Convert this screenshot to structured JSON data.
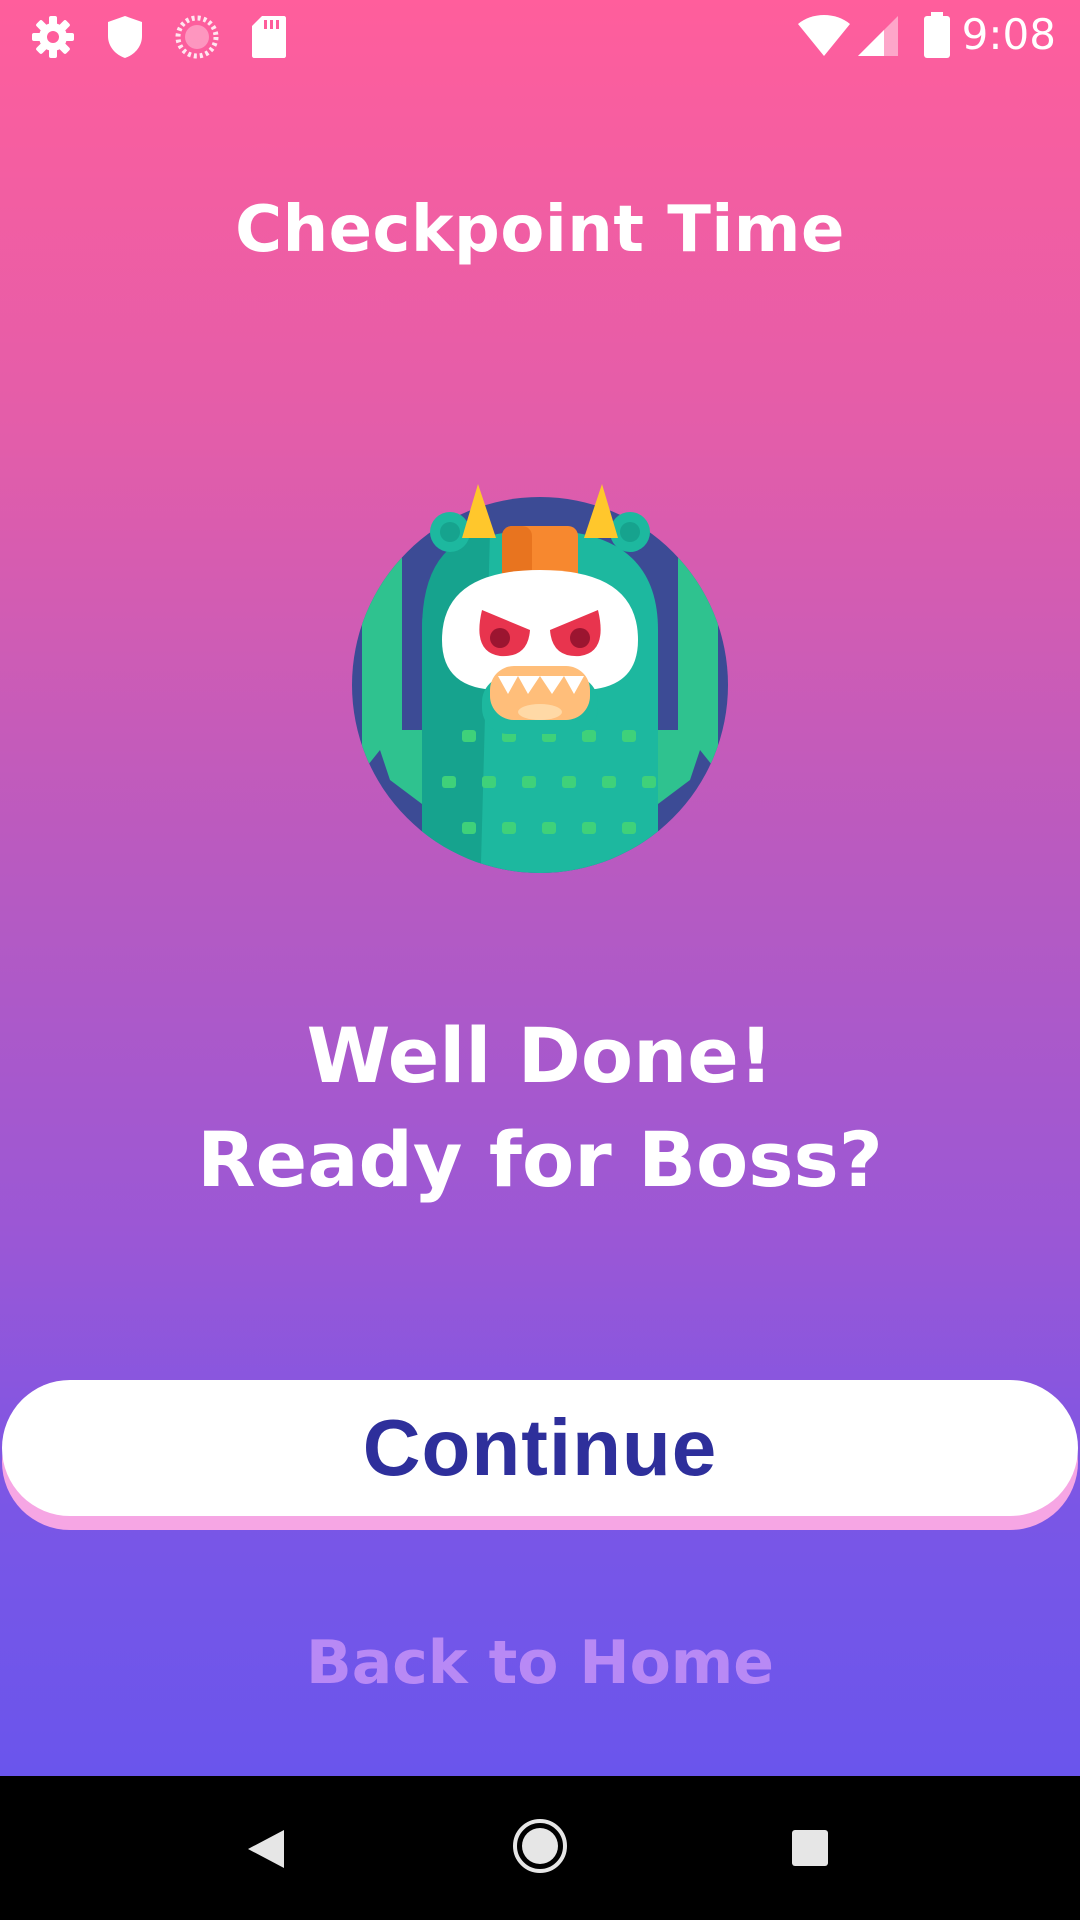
{
  "status_bar": {
    "time": "9:08",
    "left_icons": [
      "gear-icon",
      "shield-icon",
      "loading-icon",
      "sd-card-icon"
    ],
    "right_icons": [
      "wifi-icon",
      "cellular-signal-icon",
      "battery-icon"
    ]
  },
  "screen": {
    "title": "Checkpoint Time",
    "headline_line1": "Well Done!",
    "headline_line2": "Ready for Boss?",
    "continue_label": "Continue",
    "back_home_label": "Back to Home",
    "illustration": "boss-monster-icon"
  },
  "nav_bar": {
    "buttons": [
      "back-icon",
      "home-icon",
      "recents-icon"
    ]
  },
  "colors": {
    "gradient_top": "#FF5E9C",
    "gradient_bottom": "#6A55EC",
    "button_text": "#2E2F9B",
    "button_shadow": "#F6A6E4",
    "link_text": "#B889F5"
  }
}
